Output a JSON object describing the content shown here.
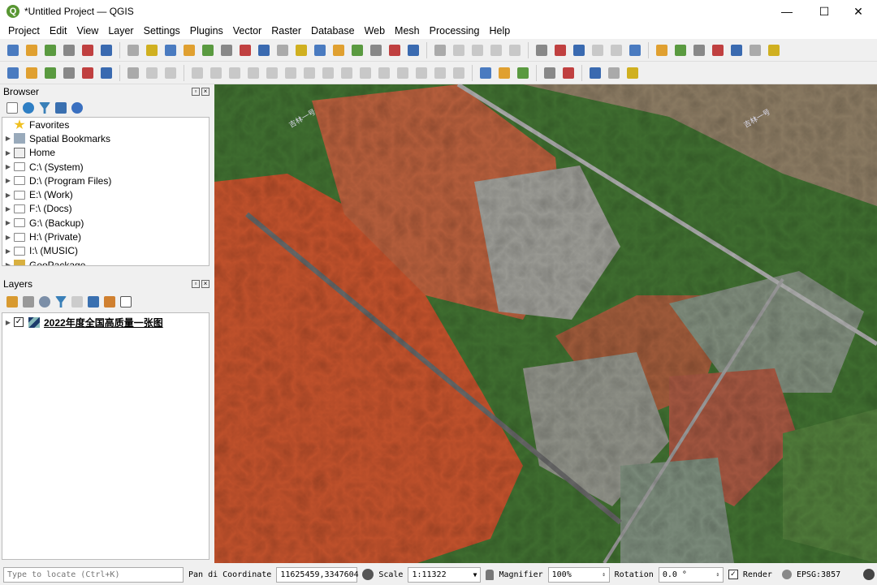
{
  "window": {
    "title": "*Untitled Project — QGIS",
    "logo": "Q",
    "minimize": "—",
    "maximize": "☐",
    "close": "✕"
  },
  "menu": [
    "Project",
    "Edit",
    "View",
    "Layer",
    "Settings",
    "Plugins",
    "Vector",
    "Raster",
    "Database",
    "Web",
    "Mesh",
    "Processing",
    "Help"
  ],
  "browser": {
    "title": "Browser",
    "items": [
      {
        "label": "Favorites",
        "icon": "star-icon"
      },
      {
        "label": "Spatial Bookmarks",
        "icon": "bookmark-icon"
      },
      {
        "label": "Home",
        "icon": "home-icon"
      },
      {
        "label": "C:\\ (System)",
        "icon": "folder-icon"
      },
      {
        "label": "D:\\ (Program Files)",
        "icon": "folder-icon"
      },
      {
        "label": "E:\\ (Work)",
        "icon": "folder-icon"
      },
      {
        "label": "F:\\ (Docs)",
        "icon": "folder-icon"
      },
      {
        "label": "G:\\ (Backup)",
        "icon": "folder-icon"
      },
      {
        "label": "H:\\ (Private)",
        "icon": "folder-icon"
      },
      {
        "label": "I:\\ (MUSIC)",
        "icon": "folder-icon"
      },
      {
        "label": "GeoPackage",
        "icon": "geopackage-icon"
      }
    ]
  },
  "layers": {
    "title": "Layers",
    "items": [
      {
        "label": "2022年度全国高质量一张图",
        "checked": true
      }
    ]
  },
  "map": {
    "labels": [
      "吉林一号",
      "吉林一号"
    ]
  },
  "status": {
    "locate_placeholder": "Type to locate (Ctrl+K)",
    "pan_label": "Pan di",
    "coordinate_label": "Coordinate",
    "coordinate": "11625459,3347604",
    "scale_label": "Scale",
    "scale": "1:11322",
    "magnifier_label": "Magnifier",
    "magnifier": "100%",
    "rotation_label": "Rotation",
    "rotation": "0.0 °",
    "render_label": "Render",
    "render_checked": true,
    "crs": "EPSG:3857"
  }
}
